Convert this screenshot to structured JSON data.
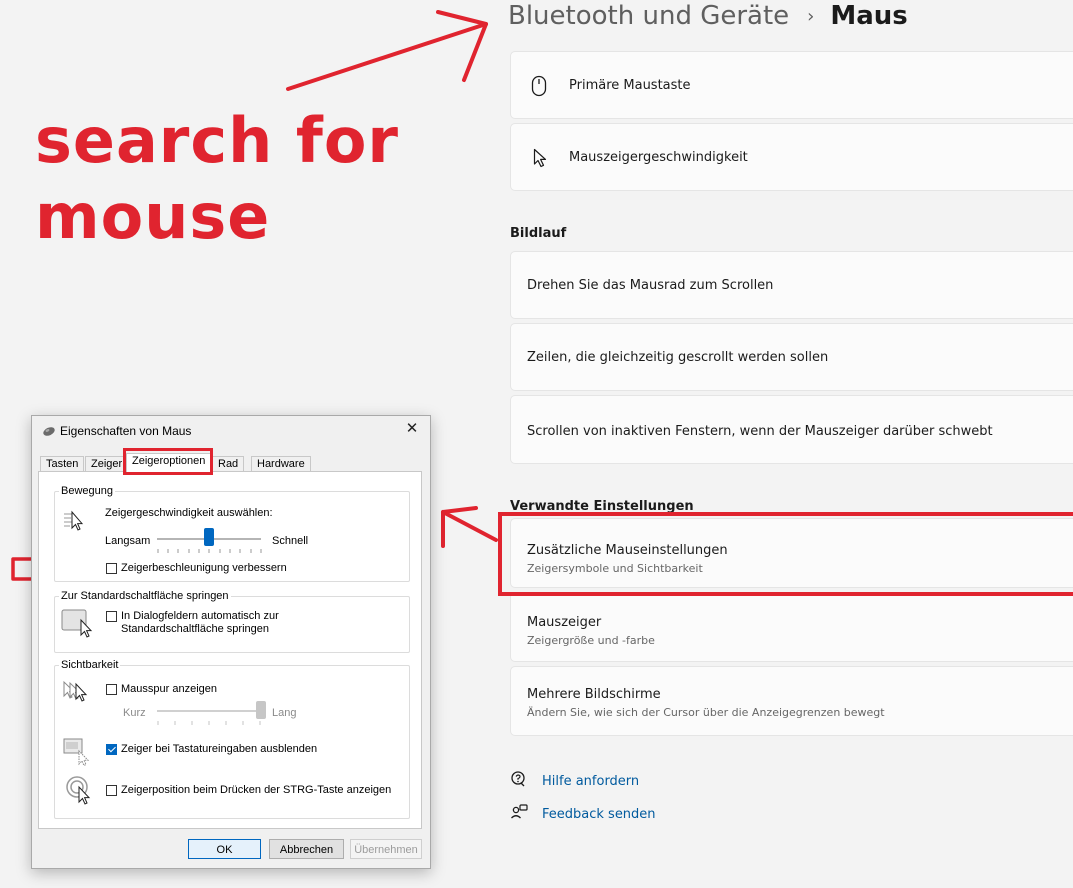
{
  "breadcrumb": {
    "parent": "Bluetooth und Geräte",
    "separator": "›",
    "current": "Maus"
  },
  "cards": {
    "primary_button": {
      "title": "Primäre Maustaste",
      "icon": "mouse-icon"
    },
    "pointer_speed": {
      "title": "Mauszeigergeschwindigkeit",
      "icon": "pointer-arrow-icon"
    },
    "scroll_wheel": {
      "title": "Drehen Sie das Mausrad zum Scrollen"
    },
    "lines_scroll": {
      "title": "Zeilen, die gleichzeitig gescrollt werden sollen"
    },
    "inactive_scroll": {
      "title": "Scrollen von inaktiven Fenstern, wenn der Mauszeiger darüber schwebt"
    },
    "additional_mouse": {
      "title": "Zusätzliche Mauseinstellungen",
      "subtitle": "Zeigersymbole und Sichtbarkeit"
    },
    "mouse_pointer": {
      "title": "Mauszeiger",
      "subtitle": "Zeigergröße und -farbe"
    },
    "multiple_displays": {
      "title": "Mehrere Bildschirme",
      "subtitle": "Ändern Sie, wie sich der Cursor über die Anzeigegrenzen bewegt"
    }
  },
  "sections": {
    "scroll": "Bildlauf",
    "related": "Verwandte Einstellungen"
  },
  "help": {
    "get_help": "Hilfe anfordern",
    "feedback": "Feedback senden"
  },
  "annotation": {
    "line1": "search for",
    "line2": "mouse",
    "color": "#e0242f"
  },
  "dialog": {
    "title": "Eigenschaften von Maus",
    "tabs": [
      "Tasten",
      "Zeiger",
      "Zeigeroptionen",
      "Rad",
      "Hardware"
    ],
    "active_tab": "Zeigeroptionen",
    "motion": {
      "group": "Bewegung",
      "speed_label": "Zeigergeschwindigkeit auswählen:",
      "slow": "Langsam",
      "fast": "Schnell",
      "speed_level": 0.5,
      "accel_label": "Zeigerbeschleunigung verbessern",
      "accel_checked": false
    },
    "snap": {
      "group": "Zur Standardschaltfläche springen",
      "label": "In Dialogfeldern automatisch zur Standardschaltfläche springen",
      "checked": false
    },
    "visibility": {
      "group": "Sichtbarkeit",
      "trails_label": "Mausspur anzeigen",
      "trails_checked": false,
      "short": "Kurz",
      "long": "Lang",
      "trail_level": 1.0,
      "hide_label": "Zeiger bei Tastatureingaben ausblenden",
      "hide_checked": true,
      "ctrl_label": "Zeigerposition beim Drücken der STRG-Taste anzeigen",
      "ctrl_checked": false
    },
    "buttons": {
      "ok": "OK",
      "cancel": "Abbrechen",
      "apply": "Übernehmen"
    }
  }
}
